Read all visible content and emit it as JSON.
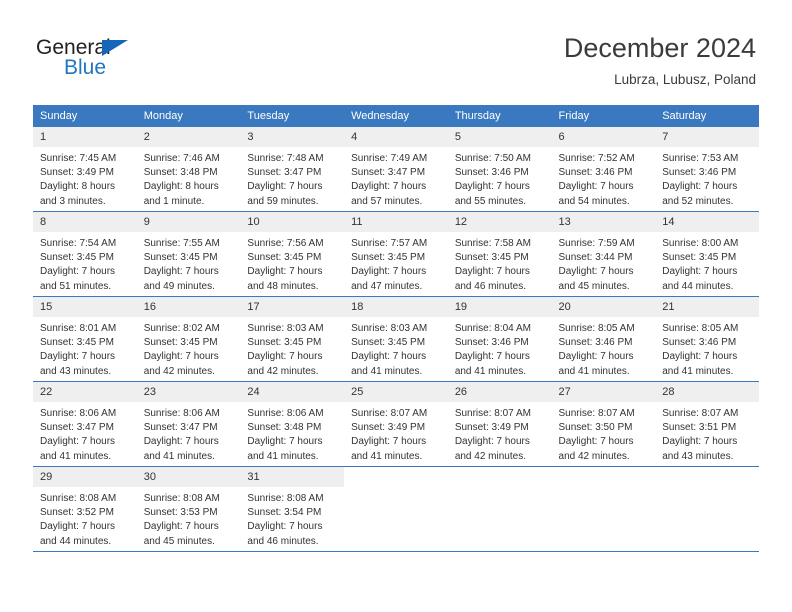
{
  "brand": {
    "name_part1": "General",
    "name_part2": "Blue",
    "triangle_icon": "triangle-logo-icon",
    "color_primary": "#1f77c4",
    "color_text": "#222222"
  },
  "header": {
    "title": "December 2024",
    "subtitle": "Lubrza, Lubusz, Poland"
  },
  "colors": {
    "header_bg": "#3a79bf",
    "daynum_bg": "#efefef",
    "text": "#333333",
    "grid_line": "#3a79bf"
  },
  "calendar": {
    "weekday_headers": [
      "Sunday",
      "Monday",
      "Tuesday",
      "Wednesday",
      "Thursday",
      "Friday",
      "Saturday"
    ],
    "weeks": [
      [
        {
          "day": "1",
          "sunrise": "Sunrise: 7:45 AM",
          "sunset": "Sunset: 3:49 PM",
          "daylight1": "Daylight: 8 hours",
          "daylight2": "and 3 minutes."
        },
        {
          "day": "2",
          "sunrise": "Sunrise: 7:46 AM",
          "sunset": "Sunset: 3:48 PM",
          "daylight1": "Daylight: 8 hours",
          "daylight2": "and 1 minute."
        },
        {
          "day": "3",
          "sunrise": "Sunrise: 7:48 AM",
          "sunset": "Sunset: 3:47 PM",
          "daylight1": "Daylight: 7 hours",
          "daylight2": "and 59 minutes."
        },
        {
          "day": "4",
          "sunrise": "Sunrise: 7:49 AM",
          "sunset": "Sunset: 3:47 PM",
          "daylight1": "Daylight: 7 hours",
          "daylight2": "and 57 minutes."
        },
        {
          "day": "5",
          "sunrise": "Sunrise: 7:50 AM",
          "sunset": "Sunset: 3:46 PM",
          "daylight1": "Daylight: 7 hours",
          "daylight2": "and 55 minutes."
        },
        {
          "day": "6",
          "sunrise": "Sunrise: 7:52 AM",
          "sunset": "Sunset: 3:46 PM",
          "daylight1": "Daylight: 7 hours",
          "daylight2": "and 54 minutes."
        },
        {
          "day": "7",
          "sunrise": "Sunrise: 7:53 AM",
          "sunset": "Sunset: 3:46 PM",
          "daylight1": "Daylight: 7 hours",
          "daylight2": "and 52 minutes."
        }
      ],
      [
        {
          "day": "8",
          "sunrise": "Sunrise: 7:54 AM",
          "sunset": "Sunset: 3:45 PM",
          "daylight1": "Daylight: 7 hours",
          "daylight2": "and 51 minutes."
        },
        {
          "day": "9",
          "sunrise": "Sunrise: 7:55 AM",
          "sunset": "Sunset: 3:45 PM",
          "daylight1": "Daylight: 7 hours",
          "daylight2": "and 49 minutes."
        },
        {
          "day": "10",
          "sunrise": "Sunrise: 7:56 AM",
          "sunset": "Sunset: 3:45 PM",
          "daylight1": "Daylight: 7 hours",
          "daylight2": "and 48 minutes."
        },
        {
          "day": "11",
          "sunrise": "Sunrise: 7:57 AM",
          "sunset": "Sunset: 3:45 PM",
          "daylight1": "Daylight: 7 hours",
          "daylight2": "and 47 minutes."
        },
        {
          "day": "12",
          "sunrise": "Sunrise: 7:58 AM",
          "sunset": "Sunset: 3:45 PM",
          "daylight1": "Daylight: 7 hours",
          "daylight2": "and 46 minutes."
        },
        {
          "day": "13",
          "sunrise": "Sunrise: 7:59 AM",
          "sunset": "Sunset: 3:44 PM",
          "daylight1": "Daylight: 7 hours",
          "daylight2": "and 45 minutes."
        },
        {
          "day": "14",
          "sunrise": "Sunrise: 8:00 AM",
          "sunset": "Sunset: 3:45 PM",
          "daylight1": "Daylight: 7 hours",
          "daylight2": "and 44 minutes."
        }
      ],
      [
        {
          "day": "15",
          "sunrise": "Sunrise: 8:01 AM",
          "sunset": "Sunset: 3:45 PM",
          "daylight1": "Daylight: 7 hours",
          "daylight2": "and 43 minutes."
        },
        {
          "day": "16",
          "sunrise": "Sunrise: 8:02 AM",
          "sunset": "Sunset: 3:45 PM",
          "daylight1": "Daylight: 7 hours",
          "daylight2": "and 42 minutes."
        },
        {
          "day": "17",
          "sunrise": "Sunrise: 8:03 AM",
          "sunset": "Sunset: 3:45 PM",
          "daylight1": "Daylight: 7 hours",
          "daylight2": "and 42 minutes."
        },
        {
          "day": "18",
          "sunrise": "Sunrise: 8:03 AM",
          "sunset": "Sunset: 3:45 PM",
          "daylight1": "Daylight: 7 hours",
          "daylight2": "and 41 minutes."
        },
        {
          "day": "19",
          "sunrise": "Sunrise: 8:04 AM",
          "sunset": "Sunset: 3:46 PM",
          "daylight1": "Daylight: 7 hours",
          "daylight2": "and 41 minutes."
        },
        {
          "day": "20",
          "sunrise": "Sunrise: 8:05 AM",
          "sunset": "Sunset: 3:46 PM",
          "daylight1": "Daylight: 7 hours",
          "daylight2": "and 41 minutes."
        },
        {
          "day": "21",
          "sunrise": "Sunrise: 8:05 AM",
          "sunset": "Sunset: 3:46 PM",
          "daylight1": "Daylight: 7 hours",
          "daylight2": "and 41 minutes."
        }
      ],
      [
        {
          "day": "22",
          "sunrise": "Sunrise: 8:06 AM",
          "sunset": "Sunset: 3:47 PM",
          "daylight1": "Daylight: 7 hours",
          "daylight2": "and 41 minutes."
        },
        {
          "day": "23",
          "sunrise": "Sunrise: 8:06 AM",
          "sunset": "Sunset: 3:47 PM",
          "daylight1": "Daylight: 7 hours",
          "daylight2": "and 41 minutes."
        },
        {
          "day": "24",
          "sunrise": "Sunrise: 8:06 AM",
          "sunset": "Sunset: 3:48 PM",
          "daylight1": "Daylight: 7 hours",
          "daylight2": "and 41 minutes."
        },
        {
          "day": "25",
          "sunrise": "Sunrise: 8:07 AM",
          "sunset": "Sunset: 3:49 PM",
          "daylight1": "Daylight: 7 hours",
          "daylight2": "and 41 minutes."
        },
        {
          "day": "26",
          "sunrise": "Sunrise: 8:07 AM",
          "sunset": "Sunset: 3:49 PM",
          "daylight1": "Daylight: 7 hours",
          "daylight2": "and 42 minutes."
        },
        {
          "day": "27",
          "sunrise": "Sunrise: 8:07 AM",
          "sunset": "Sunset: 3:50 PM",
          "daylight1": "Daylight: 7 hours",
          "daylight2": "and 42 minutes."
        },
        {
          "day": "28",
          "sunrise": "Sunrise: 8:07 AM",
          "sunset": "Sunset: 3:51 PM",
          "daylight1": "Daylight: 7 hours",
          "daylight2": "and 43 minutes."
        }
      ],
      [
        {
          "day": "29",
          "sunrise": "Sunrise: 8:08 AM",
          "sunset": "Sunset: 3:52 PM",
          "daylight1": "Daylight: 7 hours",
          "daylight2": "and 44 minutes."
        },
        {
          "day": "30",
          "sunrise": "Sunrise: 8:08 AM",
          "sunset": "Sunset: 3:53 PM",
          "daylight1": "Daylight: 7 hours",
          "daylight2": "and 45 minutes."
        },
        {
          "day": "31",
          "sunrise": "Sunrise: 8:08 AM",
          "sunset": "Sunset: 3:54 PM",
          "daylight1": "Daylight: 7 hours",
          "daylight2": "and 46 minutes."
        },
        {
          "day": "",
          "sunrise": "",
          "sunset": "",
          "daylight1": "",
          "daylight2": ""
        },
        {
          "day": "",
          "sunrise": "",
          "sunset": "",
          "daylight1": "",
          "daylight2": ""
        },
        {
          "day": "",
          "sunrise": "",
          "sunset": "",
          "daylight1": "",
          "daylight2": ""
        },
        {
          "day": "",
          "sunrise": "",
          "sunset": "",
          "daylight1": "",
          "daylight2": ""
        }
      ]
    ]
  }
}
